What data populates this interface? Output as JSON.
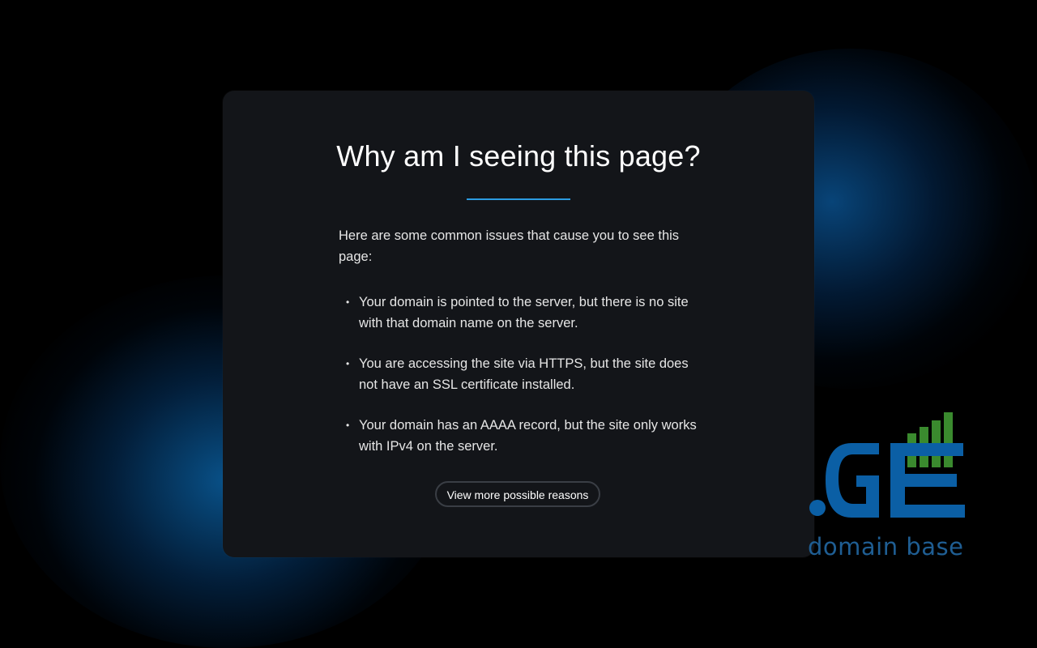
{
  "card": {
    "title": "Why am I seeing this page?",
    "intro": "Here are some common issues that cause you to see this page:",
    "reasons": [
      "Your domain is pointed to the server, but there is no site with that domain name on the server.",
      "You are accessing the site via HTTPS, but the site does not have an SSL certificate installed.",
      "Your domain has an AAAA record, but the site only works with IPv4 on the server."
    ],
    "bullet": "•",
    "more_button_label": "View more possible reasons"
  },
  "logo": {
    "text": ".GE",
    "tagline": "domain base"
  },
  "colors": {
    "background": "#000000",
    "card": "#131519",
    "accent": "#2c9be0",
    "logo_blue": "#0b5fa5",
    "logo_green": "#3a8a2e",
    "tagline": "#1f5e93"
  },
  "icons": {
    "logo": "signal-bars-logo-icon"
  }
}
